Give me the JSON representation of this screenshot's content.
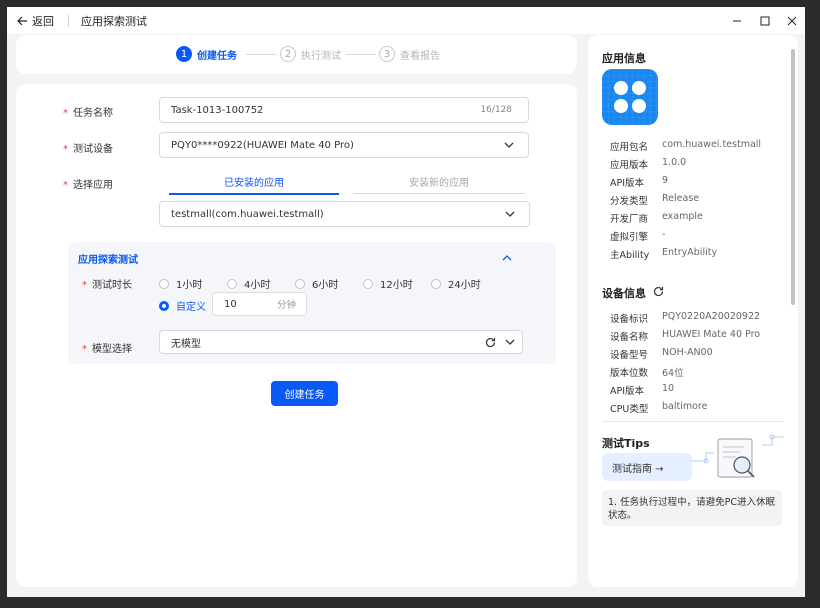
{
  "titlebar": {
    "back_label": "返回",
    "title": "应用探索测试"
  },
  "steps": [
    {
      "num": "1",
      "label": "创建任务"
    },
    {
      "num": "2",
      "label": "执行测试"
    },
    {
      "num": "3",
      "label": "查看报告"
    }
  ],
  "form": {
    "task_name_label": "任务名称",
    "task_name_value": "Task-1013-100752",
    "task_name_count": "16/128",
    "device_label": "测试设备",
    "device_value": "PQY0****0922(HUAWEI Mate 40 Pro)",
    "app_label": "选择应用",
    "tab_installed": "已安装的应用",
    "tab_install_new": "安装新的应用",
    "app_value": "testmall(com.huawei.testmall)",
    "panel_title": "应用探索测试",
    "duration_label": "测试时长",
    "duration_options": [
      "1小时",
      "4小时",
      "6小时",
      "12小时",
      "24小时"
    ],
    "custom_label": "自定义",
    "custom_value": "10",
    "custom_unit": "分钟",
    "model_label": "模型选择",
    "model_value": "无模型",
    "create_button": "创建任务"
  },
  "app_info": {
    "title": "应用信息",
    "rows": [
      {
        "k": "应用包名",
        "v": "com.huawei.testmall"
      },
      {
        "k": "应用版本",
        "v": "1.0.0"
      },
      {
        "k": "API版本",
        "v": "9"
      },
      {
        "k": "分发类型",
        "v": "Release"
      },
      {
        "k": "开发厂商",
        "v": "example"
      },
      {
        "k": "虚拟引擎",
        "v": "-"
      },
      {
        "k": "主Ability",
        "v": "EntryAbility"
      }
    ]
  },
  "device_info": {
    "title": "设备信息",
    "rows": [
      {
        "k": "设备标识",
        "v": "PQY0220A20020922"
      },
      {
        "k": "设备名称",
        "v": "HUAWEI Mate 40 Pro"
      },
      {
        "k": "设备型号",
        "v": "NOH-AN00"
      },
      {
        "k": "版本位数",
        "v": "64位"
      },
      {
        "k": "API版本",
        "v": "10"
      },
      {
        "k": "CPU类型",
        "v": "baltimore"
      }
    ]
  },
  "tips": {
    "title": "测试Tips",
    "guide_label": "测试指南 →",
    "tip_text": "1. 任务执行过程中，请避免PC进入休眠状态。"
  },
  "colors": {
    "accent": "#0a59f7",
    "required": "#e84026"
  }
}
